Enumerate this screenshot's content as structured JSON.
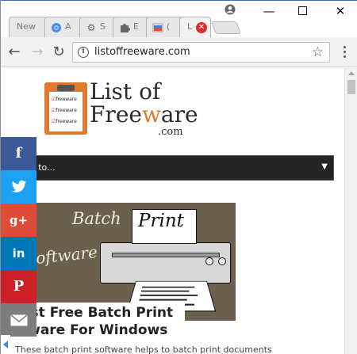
{
  "tabs": [
    {
      "label": "New",
      "icon": "none"
    },
    {
      "label": "A",
      "icon": "chrome-icon"
    },
    {
      "label": "S",
      "icon": "gear-icon"
    },
    {
      "label": "E",
      "icon": "puzzle-icon"
    },
    {
      "label": "(",
      "icon": "color-icon"
    },
    {
      "label": "L",
      "icon": "close-icon",
      "active": true
    }
  ],
  "toolbar": {
    "url": "listoffreeware.com"
  },
  "logo": {
    "line1": "List of",
    "line2_a": "Free",
    "line2_b": "w",
    "line2_c": "are",
    "suffix": ".com",
    "clip_items": [
      "freeware",
      "freeware",
      "freeware"
    ]
  },
  "goto": {
    "label": "o to..."
  },
  "article": {
    "image_batch": "Batch",
    "image_print": "Print",
    "image_software": "oftware",
    "title": "est Free Batch Print tware For Windows",
    "description": "These batch print software helps to batch print documents"
  },
  "social": [
    {
      "network": "facebook",
      "glyph": "f"
    },
    {
      "network": "twitter",
      "glyph": "🐦"
    },
    {
      "network": "google-plus",
      "glyph": "g+"
    },
    {
      "network": "linkedin",
      "glyph": "in"
    },
    {
      "network": "pinterest",
      "glyph": "P"
    },
    {
      "network": "email",
      "glyph": "✉"
    }
  ],
  "colors": {
    "accent": "#e07a2e",
    "facebook": "#3b5998",
    "twitter": "#1da1f2",
    "google_plus": "#dd4b39",
    "linkedin": "#0077b5",
    "pinterest": "#cb2027",
    "email": "#7d7d7d"
  }
}
